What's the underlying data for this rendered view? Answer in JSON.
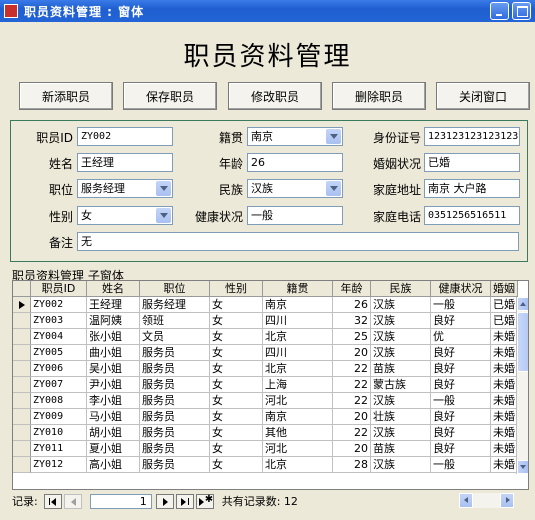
{
  "window": {
    "title": "职员资料管理 : 窗体"
  },
  "form": {
    "heading": "职员资料管理"
  },
  "toolbar": {
    "add": "新添职员",
    "save": "保存职员",
    "edit": "修改职员",
    "delete": "删除职员",
    "close": "关闭窗口"
  },
  "labels": {
    "id": "职员ID",
    "name": "姓名",
    "position": "职位",
    "gender": "性别",
    "remark": "备注",
    "native": "籍贯",
    "age": "年龄",
    "ethnicity": "民族",
    "health": "健康状况",
    "idcard": "身份证号",
    "marital": "婚姻状况",
    "address": "家庭地址",
    "phone": "家庭电话"
  },
  "record": {
    "id": "ZY002",
    "name": "王经理",
    "position": "服务经理",
    "gender": "女",
    "remark": "无",
    "native": "南京",
    "age": "26",
    "ethnicity": "汉族",
    "health": "一般",
    "idcard": "123123123123123",
    "marital": "已婚",
    "address": "南京 大户路",
    "phone": "0351256516511"
  },
  "subform": {
    "label": "职员资料管理 子窗体",
    "columns": [
      "职员ID",
      "姓名",
      "职位",
      "性别",
      "籍贯",
      "年龄",
      "民族",
      "健康状况",
      "婚姻"
    ],
    "rows": [
      [
        "ZY002",
        "王经理",
        "服务经理",
        "女",
        "南京",
        "26",
        "汉族",
        "一般",
        "已婚"
      ],
      [
        "ZY003",
        "温阿姨",
        "领班",
        "女",
        "四川",
        "32",
        "汉族",
        "良好",
        "已婚"
      ],
      [
        "ZY004",
        "张小姐",
        "文员",
        "女",
        "北京",
        "25",
        "汉族",
        "优",
        "未婚"
      ],
      [
        "ZY005",
        "曲小姐",
        "服务员",
        "女",
        "四川",
        "20",
        "汉族",
        "良好",
        "未婚"
      ],
      [
        "ZY006",
        "吴小姐",
        "服务员",
        "女",
        "北京",
        "22",
        "苗族",
        "良好",
        "未婚"
      ],
      [
        "ZY007",
        "尹小姐",
        "服务员",
        "女",
        "上海",
        "22",
        "蒙古族",
        "良好",
        "未婚"
      ],
      [
        "ZY008",
        "李小姐",
        "服务员",
        "女",
        "河北",
        "22",
        "汉族",
        "一般",
        "未婚"
      ],
      [
        "ZY009",
        "马小姐",
        "服务员",
        "女",
        "南京",
        "20",
        "壮族",
        "良好",
        "未婚"
      ],
      [
        "ZY010",
        "胡小姐",
        "服务员",
        "女",
        "其他",
        "22",
        "汉族",
        "良好",
        "未婚"
      ],
      [
        "ZY011",
        "夏小姐",
        "服务员",
        "女",
        "河北",
        "20",
        "苗族",
        "良好",
        "未婚"
      ],
      [
        "ZY012",
        "高小姐",
        "服务员",
        "女",
        "北京",
        "28",
        "汉族",
        "一般",
        "未婚"
      ]
    ]
  },
  "navigator": {
    "label": "记录:",
    "current": "1",
    "total_text": "共有记录数: 12"
  }
}
